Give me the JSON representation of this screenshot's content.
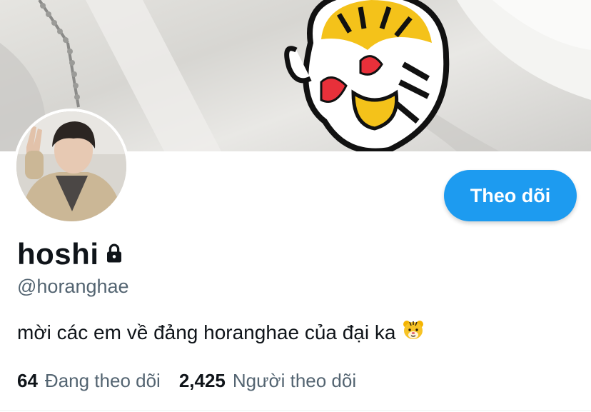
{
  "profile": {
    "display_name": "hoshi",
    "handle": "@horanghae",
    "bio": "mời các em về đảng horanghae của đại ka",
    "bio_emoji_icon": "tiger-face-icon",
    "locked_icon": "lock-icon"
  },
  "actions": {
    "follow_label": "Theo dõi"
  },
  "stats": {
    "following_count": "64",
    "following_label": "Đang theo dõi",
    "followers_count": "2,425",
    "followers_label": "Người theo dõi"
  },
  "colors": {
    "accent": "#1d9bf0",
    "text_primary": "#0f1419",
    "text_secondary": "#536471"
  }
}
